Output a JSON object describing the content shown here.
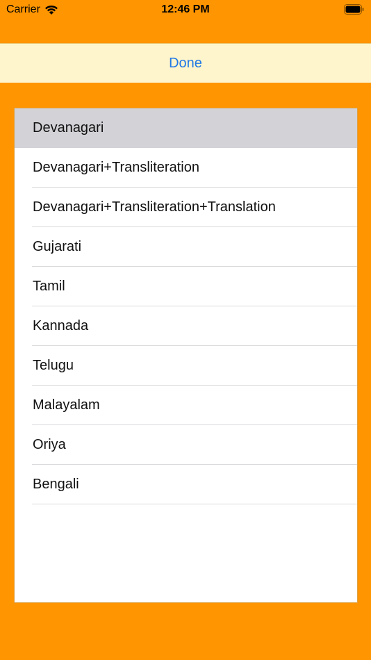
{
  "status_bar": {
    "carrier": "Carrier",
    "time": "12:46 PM"
  },
  "toolbar": {
    "done_label": "Done"
  },
  "language_list": {
    "selected_index": 0,
    "items": [
      "Devanagari",
      "Devanagari+Transliteration",
      "Devanagari+Transliteration+Translation",
      "Gujarati",
      "Tamil",
      "Kannada",
      "Telugu",
      "Malayalam",
      "Oriya",
      "Bengali"
    ]
  },
  "colors": {
    "background": "#FF9500",
    "toolbar_bg": "#FFF5CC",
    "accent": "#1E78E6",
    "selected_row": "#D2D2D7"
  },
  "icons": [
    "wifi-icon",
    "battery-icon"
  ]
}
